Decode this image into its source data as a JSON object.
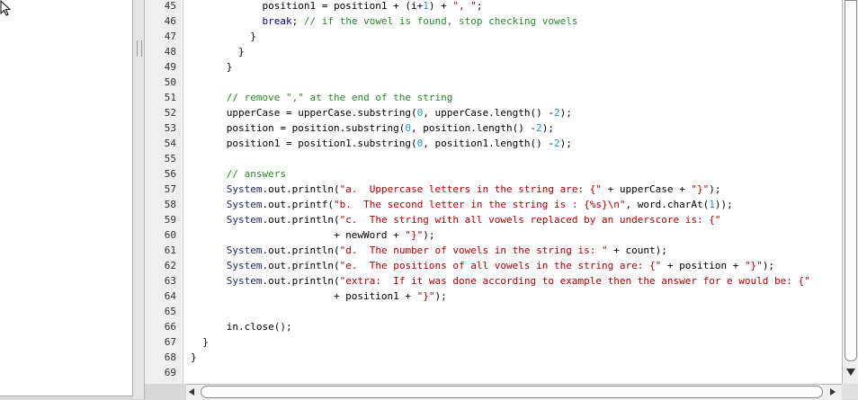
{
  "editor": {
    "lines": [
      {
        "n": "45",
        "segs": [
          [
            "c",
            "            position1 = position1 + (i+"
          ],
          [
            "num",
            "1"
          ],
          [
            "c",
            ") + "
          ],
          [
            "str",
            "\", \""
          ],
          [
            "c",
            ";"
          ]
        ]
      },
      {
        "n": "46",
        "segs": [
          [
            "c",
            "            "
          ],
          [
            "kw",
            "break"
          ],
          [
            "c",
            "; "
          ],
          [
            "cmt",
            "// if the vowel is found, stop checking vowels"
          ]
        ]
      },
      {
        "n": "47",
        "segs": [
          [
            "c",
            "          }"
          ]
        ]
      },
      {
        "n": "48",
        "segs": [
          [
            "c",
            "        }"
          ]
        ]
      },
      {
        "n": "49",
        "segs": [
          [
            "c",
            "      }"
          ]
        ]
      },
      {
        "n": "50",
        "segs": [
          [
            "c",
            ""
          ]
        ]
      },
      {
        "n": "51",
        "segs": [
          [
            "c",
            "      "
          ],
          [
            "cmt",
            "// remove \",\" at the end of the string"
          ]
        ]
      },
      {
        "n": "52",
        "segs": [
          [
            "c",
            "      upperCase = upperCase.substring("
          ],
          [
            "num",
            "0"
          ],
          [
            "c",
            ", upperCase.length() -"
          ],
          [
            "num",
            "2"
          ],
          [
            "c",
            ");"
          ]
        ]
      },
      {
        "n": "53",
        "segs": [
          [
            "c",
            "      position = position.substring("
          ],
          [
            "num",
            "0"
          ],
          [
            "c",
            ", position.length() -"
          ],
          [
            "num",
            "2"
          ],
          [
            "c",
            ");"
          ]
        ]
      },
      {
        "n": "54",
        "segs": [
          [
            "c",
            "      position1 = position1.substring("
          ],
          [
            "num",
            "0"
          ],
          [
            "c",
            ", position1.length() -"
          ],
          [
            "num",
            "2"
          ],
          [
            "c",
            ");"
          ]
        ]
      },
      {
        "n": "55",
        "segs": [
          [
            "c",
            ""
          ]
        ]
      },
      {
        "n": "56",
        "segs": [
          [
            "c",
            "      "
          ],
          [
            "cmt",
            "// answers"
          ]
        ]
      },
      {
        "n": "57",
        "segs": [
          [
            "c",
            "      "
          ],
          [
            "sys",
            "System"
          ],
          [
            "c",
            ".out.println("
          ],
          [
            "str",
            "\"a.  Uppercase letters in the string are: {\""
          ],
          [
            "c",
            " + upperCase + "
          ],
          [
            "str",
            "\"}\""
          ],
          [
            "c",
            ");"
          ]
        ]
      },
      {
        "n": "58",
        "segs": [
          [
            "c",
            "      "
          ],
          [
            "sys",
            "System"
          ],
          [
            "c",
            ".out.printf("
          ],
          [
            "str",
            "\"b.  The second letter in the string is : {%s}\\n\""
          ],
          [
            "c",
            ", word.charAt("
          ],
          [
            "num",
            "1"
          ],
          [
            "c",
            "));"
          ]
        ]
      },
      {
        "n": "59",
        "segs": [
          [
            "c",
            "      "
          ],
          [
            "sys",
            "System"
          ],
          [
            "c",
            ".out.println("
          ],
          [
            "str",
            "\"c.  The string with all vowels replaced by an underscore is: {\""
          ]
        ]
      },
      {
        "n": "60",
        "segs": [
          [
            "c",
            "                        + newWord + "
          ],
          [
            "str",
            "\"}\""
          ],
          [
            "c",
            ");"
          ]
        ]
      },
      {
        "n": "61",
        "segs": [
          [
            "c",
            "      "
          ],
          [
            "sys",
            "System"
          ],
          [
            "c",
            ".out.println("
          ],
          [
            "str",
            "\"d.  The number of vowels in the string is: \""
          ],
          [
            "c",
            " + count);"
          ]
        ]
      },
      {
        "n": "62",
        "segs": [
          [
            "c",
            "      "
          ],
          [
            "sys",
            "System"
          ],
          [
            "c",
            ".out.println("
          ],
          [
            "str",
            "\"e.  The positions of all vowels in the string are: {\""
          ],
          [
            "c",
            " + position + "
          ],
          [
            "str",
            "\"}\""
          ],
          [
            "c",
            ");"
          ]
        ]
      },
      {
        "n": "63",
        "segs": [
          [
            "c",
            "      "
          ],
          [
            "sys",
            "System"
          ],
          [
            "c",
            ".out.println("
          ],
          [
            "str",
            "\"extra:  If it was done according to example then the answer for e would be: {\""
          ]
        ]
      },
      {
        "n": "64",
        "segs": [
          [
            "c",
            "                        + position1 + "
          ],
          [
            "str",
            "\"}\""
          ],
          [
            "c",
            ");"
          ]
        ]
      },
      {
        "n": "65",
        "segs": [
          [
            "c",
            ""
          ]
        ]
      },
      {
        "n": "66",
        "segs": [
          [
            "c",
            "      in.close();"
          ]
        ]
      },
      {
        "n": "67",
        "segs": [
          [
            "c",
            "  }"
          ]
        ]
      },
      {
        "n": "68",
        "segs": [
          [
            "c",
            "}"
          ]
        ]
      },
      {
        "n": "69",
        "segs": [
          [
            "c",
            ""
          ]
        ]
      }
    ]
  }
}
